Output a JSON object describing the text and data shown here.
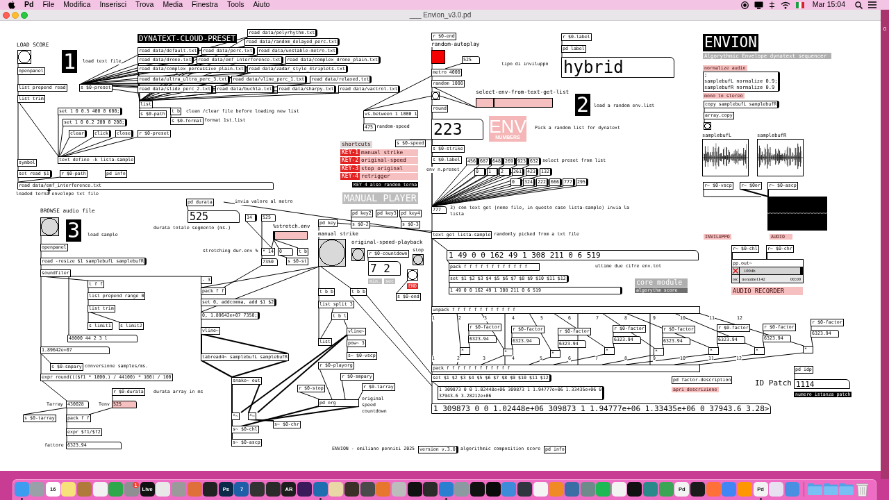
{
  "menu_bar": {
    "app_name": "Pd",
    "menus": [
      "File",
      "Modifica",
      "Inserisci",
      "Trova",
      "Media",
      "Finestra",
      "Tools",
      "Aiuto"
    ],
    "clock": "Mar 15:04"
  },
  "window": {
    "title": "___ Envion_v3.0.pd"
  },
  "desktop": {
    "edge_text": "0"
  },
  "patch": {
    "boxes": [
      {
        "kind": "comment",
        "text": "LOAD SCORE"
      },
      {
        "kind": "bang"
      },
      {
        "kind": "label",
        "text": "1",
        "color": "#000000"
      },
      {
        "kind": "comment",
        "text": "load text file"
      },
      {
        "kind": "object",
        "text": "openpanel"
      },
      {
        "kind": "object",
        "text": "list prepend read"
      },
      {
        "kind": "object",
        "text": "s $0-preset"
      },
      {
        "kind": "object",
        "text": "list trim"
      },
      {
        "kind": "message",
        "text": "set 1 0 0.5 400 0 600;"
      },
      {
        "kind": "message",
        "text": "set 1 0 0.2 200 0 200;"
      },
      {
        "kind": "message",
        "text": "clear"
      },
      {
        "kind": "message",
        "text": "click"
      },
      {
        "kind": "message",
        "text": "close"
      },
      {
        "kind": "object",
        "text": "r $0-preset"
      },
      {
        "kind": "object",
        "text": "text define -k lista-sample"
      },
      {
        "kind": "object",
        "text": "symbol"
      },
      {
        "kind": "message",
        "text": "set read $1"
      },
      {
        "kind": "object",
        "text": "r $0-path"
      },
      {
        "kind": "object",
        "text": "pd info"
      },
      {
        "kind": "symbol",
        "text": "read data/emf_interference.txt"
      },
      {
        "kind": "comment",
        "text": "loaded terna envelope txt file"
      },
      {
        "kind": "label",
        "text": "DYNATEXT-CLOUD-PRESET",
        "color": "#000000"
      },
      {
        "kind": "message",
        "text": "read data/polyrhythm.txt"
      },
      {
        "kind": "message",
        "text": "read data/random_delayed_perc.txt"
      },
      {
        "kind": "message",
        "text": "read data/default.txt"
      },
      {
        "kind": "message",
        "text": "read data/perc.txt"
      },
      {
        "kind": "message",
        "text": "read data/unstable-metro.txt"
      },
      {
        "kind": "message",
        "text": "read data/drone.txt"
      },
      {
        "kind": "message",
        "text": "read data/emf_interference.txt"
      },
      {
        "kind": "message",
        "text": "read data/complex_drone_plain.txt"
      },
      {
        "kind": "message",
        "text": "read data/complex_percussive_plain.txt"
      },
      {
        "kind": "message",
        "text": "read data/zadar_style_4triplets.txt"
      },
      {
        "kind": "message",
        "text": "read data/ultra_ultra_perc_3.txt"
      },
      {
        "kind": "message",
        "text": "read data/vline_perc_1.txt"
      },
      {
        "kind": "message",
        "text": "read data/relaxed.txt"
      },
      {
        "kind": "message",
        "text": "read data/slide_perc_2.txt"
      },
      {
        "kind": "message",
        "text": "read data/buchla.txt"
      },
      {
        "kind": "message",
        "text": "read data/sharpy.txt"
      },
      {
        "kind": "message",
        "text": "read data/vactrol.txt"
      },
      {
        "kind": "object",
        "text": "list"
      },
      {
        "kind": "object",
        "text": "s $0-path"
      },
      {
        "kind": "object",
        "text": "t b"
      },
      {
        "kind": "comment",
        "text": "clean /clear file before loading new list"
      },
      {
        "kind": "object",
        "text": "s $0-format"
      },
      {
        "kind": "comment",
        "text": "format 1st.list"
      },
      {
        "kind": "object",
        "text": "r $0-end"
      },
      {
        "kind": "comment",
        "text": "random-autoplay"
      },
      {
        "kind": "toggle",
        "color": "#f40000",
        "on": false
      },
      {
        "kind": "number",
        "text": "525"
      },
      {
        "kind": "object",
        "text": "metro 4000"
      },
      {
        "kind": "object",
        "text": "random 1000"
      },
      {
        "kind": "bang"
      },
      {
        "kind": "comment",
        "text": "select-env-from-text-get-list"
      },
      {
        "kind": "slider",
        "color": "#f7c0c0",
        "level": 0.22
      },
      {
        "kind": "object",
        "text": "round"
      },
      {
        "kind": "label",
        "text": "2",
        "color": "#000000"
      },
      {
        "kind": "comment",
        "text": "load a random env.list"
      },
      {
        "kind": "comment",
        "text": "tipo di inviluppo"
      },
      {
        "kind": "object",
        "text": "r $0-label"
      },
      {
        "kind": "object",
        "text": "pd label"
      },
      {
        "kind": "symbol",
        "text": "hybrid"
      },
      {
        "kind": "object",
        "text": "vs.between 1 1000 1"
      },
      {
        "kind": "number",
        "text": "475"
      },
      {
        "kind": "comment",
        "text": "random-speed"
      },
      {
        "kind": "number",
        "text": "223"
      },
      {
        "kind": "env_badge",
        "text": "ENV",
        "subtext": "NUMBERS",
        "color": "#f4b6b6"
      },
      {
        "kind": "comment",
        "text": "Pick a random list for dynatext"
      },
      {
        "kind": "label",
        "text": "shortcuts",
        "color": "#dcdcdc"
      },
      {
        "kind": "object",
        "text": "s $0-speed"
      },
      {
        "kind": "label",
        "text": "KEY-1",
        "color": "#e52222"
      },
      {
        "kind": "label",
        "text": "manual strike",
        "color": "#f7c0c0"
      },
      {
        "kind": "label",
        "text": "KEY-2",
        "color": "#e52222"
      },
      {
        "kind": "label",
        "text": "original-speed",
        "color": "#f7c0c0"
      },
      {
        "kind": "label",
        "text": "KEY-3",
        "color": "#e52222"
      },
      {
        "kind": "label",
        "text": "stop original",
        "color": "#f7c0c0"
      },
      {
        "kind": "label",
        "text": "KEY-4",
        "color": "#e52222"
      },
      {
        "kind": "label",
        "text": "retrigger",
        "color": "#f7c0c0"
      },
      {
        "kind": "label",
        "text": "KEY 4 also random terna",
        "color": "#000000"
      },
      {
        "kind": "label",
        "text": "MANUAL PLAYER",
        "color": "#bdbdbd"
      },
      {
        "kind": "object",
        "text": "pd key2"
      },
      {
        "kind": "object",
        "text": "pd key3"
      },
      {
        "kind": "object",
        "text": "pd key4"
      },
      {
        "kind": "object",
        "text": "s $0-strike"
      },
      {
        "kind": "object",
        "text": "s $0-label"
      },
      {
        "kind": "comment",
        "text": "env n.preset"
      },
      {
        "kind": "message",
        "text": "456"
      },
      {
        "kind": "message",
        "text": "687"
      },
      {
        "kind": "message",
        "text": "648"
      },
      {
        "kind": "message",
        "text": "269"
      },
      {
        "kind": "message",
        "text": "923"
      },
      {
        "kind": "message",
        "text": "632"
      },
      {
        "kind": "comment",
        "text": "select preset from list"
      },
      {
        "kind": "message",
        "text": "0"
      },
      {
        "kind": "message",
        "text": "1"
      },
      {
        "kind": "message",
        "text": "2"
      },
      {
        "kind": "message",
        "text": "261"
      },
      {
        "kind": "message",
        "text": "423"
      },
      {
        "kind": "message",
        "text": "132"
      },
      {
        "kind": "message",
        "text": "0"
      },
      {
        "kind": "message",
        "text": "324"
      },
      {
        "kind": "message",
        "text": "222"
      },
      {
        "kind": "message",
        "text": "666"
      },
      {
        "kind": "message",
        "text": "777"
      },
      {
        "kind": "message",
        "text": "295"
      },
      {
        "kind": "number",
        "text": "777"
      },
      {
        "kind": "comment",
        "text": "3) con text get (nome file, in questo caso lista-sample) invia la lista"
      },
      {
        "kind": "label",
        "text": "ENVION",
        "color": "#000000"
      },
      {
        "kind": "label",
        "text": "Algorythmic Envelope dynatext sequencer",
        "color": "#b0b0b0"
      },
      {
        "kind": "label",
        "text": "normalize audio",
        "color": "#f7c0c0"
      },
      {
        "kind": "message",
        "text": ";\nsamplebufL normalize 0.9;\nsamplebufR normalize 0.9"
      },
      {
        "kind": "label",
        "text": "mono to stereo",
        "color": "#f7c0c0"
      },
      {
        "kind": "message",
        "text": "copy samplebufL samplebufR"
      },
      {
        "kind": "object",
        "text": "array.copy"
      },
      {
        "kind": "bang"
      },
      {
        "kind": "array",
        "name": "samplebufL"
      },
      {
        "kind": "array",
        "name": "samplebufR"
      },
      {
        "kind": "object",
        "text": "r~ $0-vscp"
      },
      {
        "kind": "object",
        "text": "r~ $0or"
      },
      {
        "kind": "object",
        "text": "r~ $0-ascp"
      },
      {
        "kind": "scope"
      },
      {
        "kind": "label",
        "text": "INVILUPPO",
        "color": "#f7c0c0"
      },
      {
        "kind": "label",
        "text": "AUDIO",
        "color": "#f7c0c0"
      },
      {
        "kind": "object",
        "text": "r~ $0-chl"
      },
      {
        "kind": "object",
        "text": "r~ $0-chr"
      },
      {
        "kind": "recorder",
        "title": "pp.out~",
        "toggle_on": true,
        "gain_label": "100db",
        "level": 1,
        "rec_label": "rec",
        "file": "noname1142",
        "time": "00:00"
      },
      {
        "kind": "label",
        "text": "AUDIO RECORDER",
        "color": "#f7c0c0"
      },
      {
        "kind": "comment",
        "text": "BROWSE audio file"
      },
      {
        "kind": "bang",
        "color": "#d9d9d9"
      },
      {
        "kind": "label",
        "text": "3",
        "color": "#000000"
      },
      {
        "kind": "comment",
        "text": "load sample"
      },
      {
        "kind": "object",
        "text": "openpanel"
      },
      {
        "kind": "message",
        "text": "read -resize $1 samplebufL samplebufR"
      },
      {
        "kind": "object",
        "text": "soundfiler"
      },
      {
        "kind": "object",
        "text": "t f f"
      },
      {
        "kind": "object",
        "text": "list prepend range 0"
      },
      {
        "kind": "object",
        "text": "list trim"
      },
      {
        "kind": "object",
        "text": "s limit1"
      },
      {
        "kind": "object",
        "text": "s limit2"
      },
      {
        "kind": "list",
        "text": "48000 44 2 3 l"
      },
      {
        "kind": "number",
        "text": "1.89642e+07"
      },
      {
        "kind": "object",
        "text": "s $0-smpary"
      },
      {
        "kind": "comment",
        "text": "conversione samples/ms."
      },
      {
        "kind": "object",
        "text": "expr round((($f1 * 1000.) / 44100) * 100) / 100"
      },
      {
        "kind": "object",
        "text": "r $0-durata"
      },
      {
        "kind": "comment",
        "text": "durata array in ms"
      },
      {
        "kind": "comment",
        "text": "Tarray"
      },
      {
        "kind": "number",
        "text": "430028"
      },
      {
        "kind": "comment",
        "text": "Tenv"
      },
      {
        "kind": "number",
        "text": "525",
        "color": "#f7c0c0"
      },
      {
        "kind": "object",
        "text": "s $0-tarray"
      },
      {
        "kind": "object",
        "text": "pack f f"
      },
      {
        "kind": "object",
        "text": "expr $f1/$f2"
      },
      {
        "kind": "comment",
        "text": "fattore"
      },
      {
        "kind": "number",
        "text": "6323.94"
      },
      {
        "kind": "object",
        "text": "pd durata"
      },
      {
        "kind": "comment",
        "text": "invia valore al metro"
      },
      {
        "kind": "number",
        "text": "525"
      },
      {
        "kind": "comment",
        "text": "durata totale segmento (ms.)"
      },
      {
        "kind": "message",
        "text": "14"
      },
      {
        "kind": "number",
        "text": "525"
      },
      {
        "kind": "comment",
        "text": "%stretch.env"
      },
      {
        "kind": "slider",
        "color": "#f7c0c0",
        "level": 0
      },
      {
        "kind": "comment",
        "text": "stretching dur.env %"
      },
      {
        "kind": "object",
        "text": "* 14"
      },
      {
        "kind": "number",
        "text": "0"
      },
      {
        "kind": "object",
        "text": "t b"
      },
      {
        "kind": "number",
        "text": "7350"
      },
      {
        "kind": "object",
        "text": "s $0-st"
      },
      {
        "kind": "object",
        "text": "pd key"
      },
      {
        "kind": "comment",
        "text": "manual strike"
      },
      {
        "kind": "bang",
        "color": "#d9d9d9"
      },
      {
        "kind": "object",
        "text": "s $0-2"
      },
      {
        "kind": "object",
        "text": "s $0-3"
      },
      {
        "kind": "comment",
        "text": "original-speed-playback"
      },
      {
        "kind": "bang",
        "color": "#d9d9d9"
      },
      {
        "kind": "object",
        "text": "r $0-countdown"
      },
      {
        "kind": "comment",
        "text": "stop"
      },
      {
        "kind": "bang",
        "color": "#d9d9d9"
      },
      {
        "kind": "list",
        "text": "7 2"
      },
      {
        "kind": "label",
        "text": "min.",
        "color": "#bdbdbd"
      },
      {
        "kind": "label",
        "text": "sec",
        "color": "#bdbdbd"
      },
      {
        "kind": "bang"
      },
      {
        "kind": "label",
        "text": "END",
        "color": "#e52222"
      },
      {
        "kind": "object",
        "text": "s $0-end"
      },
      {
        "kind": "object",
        "text": "- 3"
      },
      {
        "kind": "object",
        "text": "pack f f"
      },
      {
        "kind": "message",
        "text": "set 0, addcomma, add $1 $2"
      },
      {
        "kind": "message",
        "text": "0, 1.89642e+07 7350;"
      },
      {
        "kind": "object",
        "text": "vline~"
      },
      {
        "kind": "object",
        "text": "tabread4~ samplebufL samplebufR"
      },
      {
        "kind": "object",
        "text": "snake~ out"
      },
      {
        "kind": "object",
        "text": "*~"
      },
      {
        "kind": "object",
        "text": "*~"
      },
      {
        "kind": "object",
        "text": "s~ $0-chl"
      },
      {
        "kind": "object",
        "text": "s~ $0-chr"
      },
      {
        "kind": "object",
        "text": "s~ $0-ascp"
      },
      {
        "kind": "object",
        "text": "t b b"
      },
      {
        "kind": "object",
        "text": "t b b"
      },
      {
        "kind": "object",
        "text": "list split 3"
      },
      {
        "kind": "object",
        "text": "t b l"
      },
      {
        "kind": "object",
        "text": "list"
      },
      {
        "kind": "object",
        "text": "vline~"
      },
      {
        "kind": "object",
        "text": "pow~ 3"
      },
      {
        "kind": "object",
        "text": "s~ $0-vscp"
      },
      {
        "kind": "object",
        "text": "r $0-playorg"
      },
      {
        "kind": "object",
        "text": "r $0-smpary"
      },
      {
        "kind": "object",
        "text": "r $0-stop"
      },
      {
        "kind": "object",
        "text": "r $0-tarray"
      },
      {
        "kind": "object",
        "text": "pd org"
      },
      {
        "kind": "comment",
        "text": "original speed countdown"
      },
      {
        "kind": "comment",
        "text": "ENVION - emiliano pennisi 2025"
      },
      {
        "kind": "object",
        "text": "text get lista-sample"
      },
      {
        "kind": "comment",
        "text": "randomly picked from a txt file"
      },
      {
        "kind": "list",
        "text": "1 49 0 0 162 49 1 308 211 0 6 519"
      },
      {
        "kind": "object",
        "text": "pack f f f f f f f f f f f f"
      },
      {
        "kind": "comment",
        "text": "ultime due cifre env.tot"
      },
      {
        "kind": "message",
        "text": "set $1 $2 $3 $4 $5 $6 $7 $8 $9 $10 $11 $12"
      },
      {
        "kind": "message",
        "text": "1 49 0 0 162 49 1 308 211 0 6 519"
      },
      {
        "kind": "label",
        "text": "core module",
        "color": "#b0b0b0"
      },
      {
        "kind": "label",
        "text": "algorythm score",
        "color": "#6e6e6e"
      },
      {
        "kind": "object",
        "text": "unpack f f f f f f f f f f f f"
      },
      {
        "kind": "comment",
        "text": "1"
      },
      {
        "kind": "comment",
        "text": "2"
      },
      {
        "kind": "comment",
        "text": "3"
      },
      {
        "kind": "comment",
        "text": "4"
      },
      {
        "kind": "comment",
        "text": "5"
      },
      {
        "kind": "comment",
        "text": "6"
      },
      {
        "kind": "comment",
        "text": "7"
      },
      {
        "kind": "comment",
        "text": "8"
      },
      {
        "kind": "comment",
        "text": "9"
      },
      {
        "kind": "comment",
        "text": "10"
      },
      {
        "kind": "comment",
        "text": "11"
      },
      {
        "kind": "comment",
        "text": "12"
      },
      {
        "kind": "object",
        "text": "r $0-factor"
      },
      {
        "kind": "object",
        "text": "r $0-factor"
      },
      {
        "kind": "object",
        "text": "r $0-factor"
      },
      {
        "kind": "object",
        "text": "r $0-factor"
      },
      {
        "kind": "object",
        "text": "r $0-factor"
      },
      {
        "kind": "object",
        "text": "r $0-factor"
      },
      {
        "kind": "object",
        "text": "r $0-factor"
      },
      {
        "kind": "object",
        "text": "r $0-factor"
      },
      {
        "kind": "number",
        "text": "6323.94"
      },
      {
        "kind": "number",
        "text": "6323.94"
      },
      {
        "kind": "number",
        "text": "6323.94"
      },
      {
        "kind": "number",
        "text": "6323.94"
      },
      {
        "kind": "number",
        "text": "6323.94"
      },
      {
        "kind": "number",
        "text": "6323.94"
      },
      {
        "kind": "number",
        "text": "6323.94"
      },
      {
        "kind": "number",
        "text": "6323.94"
      },
      {
        "kind": "object",
        "text": "*"
      },
      {
        "kind": "object",
        "text": "*"
      },
      {
        "kind": "object",
        "text": "*"
      },
      {
        "kind": "object",
        "text": "*"
      },
      {
        "kind": "object",
        "text": "*"
      },
      {
        "kind": "object",
        "text": "*"
      },
      {
        "kind": "object",
        "text": "*"
      },
      {
        "kind": "object",
        "text": "*"
      },
      {
        "kind": "comment",
        "text": "1"
      },
      {
        "kind": "comment",
        "text": "2"
      },
      {
        "kind": "comment",
        "text": "3"
      },
      {
        "kind": "comment",
        "text": "4"
      },
      {
        "kind": "comment",
        "text": "5"
      },
      {
        "kind": "comment",
        "text": "6"
      },
      {
        "kind": "comment",
        "text": "7"
      },
      {
        "kind": "comment",
        "text": "8"
      },
      {
        "kind": "comment",
        "text": "9"
      },
      {
        "kind": "comment",
        "text": "10"
      },
      {
        "kind": "comment",
        "text": "11"
      },
      {
        "kind": "comment",
        "text": "12"
      },
      {
        "kind": "object",
        "text": "pack f f f f f f f f f f f f"
      },
      {
        "kind": "message",
        "text": "set $1 $2 $3 $4 $5 $6 $7 $8 $9 $10 $11 $12"
      },
      {
        "kind": "message",
        "text": "1 309873 0 0 1.02448e+06 309873 1 1.94777e+06 1.33435e+06 0\n37943.6 3.28212e+06"
      },
      {
        "kind": "object",
        "text": "pd factor-description"
      },
      {
        "kind": "label",
        "text": "apri descrizione",
        "color": "#f7c0c0"
      },
      {
        "kind": "object",
        "text": "pd idp"
      },
      {
        "kind": "comment",
        "text": "ID Patch"
      },
      {
        "kind": "number",
        "text": "1114"
      },
      {
        "kind": "label",
        "text": "numero istanza patch",
        "color": "#000000"
      },
      {
        "kind": "list",
        "text": "1 309873 0 0 1.02448e+06 309873 1 1.94777e+06 1.33435e+06 0 37943.6 3.28>"
      },
      {
        "kind": "message",
        "text": "version v.3.0"
      },
      {
        "kind": "comment",
        "text": "algorithmic composition score"
      },
      {
        "kind": "object",
        "text": "pd info"
      }
    ]
  },
  "dock": {
    "apps": [
      {
        "color": "#3b9cf0",
        "running": true
      },
      {
        "color": "#9aa0a8",
        "running": false
      },
      {
        "color": "#ffffff",
        "label": "16",
        "running": false
      },
      {
        "color": "#f7e27a",
        "running": false
      },
      {
        "color": "#b07a3a",
        "running": false
      },
      {
        "color": "#f2f2f2",
        "running": false
      },
      {
        "color": "#2ea84a",
        "running": false
      },
      {
        "color": "#8e8e93",
        "badge": "1",
        "running": false
      },
      {
        "color": "#111111",
        "label": "Live",
        "running": false
      },
      {
        "color": "#e8e8e8",
        "running": false
      },
      {
        "color": "#9a9a9a",
        "running": false
      },
      {
        "color": "#e0703a",
        "running": false
      },
      {
        "color": "#222222",
        "running": false
      },
      {
        "color": "#0b2a4a",
        "label": "Ps",
        "running": false
      },
      {
        "color": "#1e5fa8",
        "label": "7",
        "running": false
      },
      {
        "color": "#333333",
        "running": false
      },
      {
        "color": "#2a2a2a",
        "running": false
      },
      {
        "color": "#1d1d1d",
        "label": "AR",
        "running": false
      },
      {
        "color": "#3a1a5a",
        "running": false
      },
      {
        "color": "#1f6fb0",
        "running": true
      },
      {
        "color": "#e9d8a6",
        "running": false
      },
      {
        "color": "#3a3028",
        "running": false
      },
      {
        "color": "#4a4a4a",
        "running": false
      },
      {
        "color": "#e8772e",
        "running": false
      },
      {
        "color": "#bcbcbc",
        "running": false
      },
      {
        "color": "#111111",
        "running": false
      },
      {
        "color": "#2b2b2b",
        "running": false
      },
      {
        "color": "#2a7fd0",
        "running": true
      },
      {
        "color": "#8a9aa0",
        "running": false
      },
      {
        "color": "#111111",
        "running": false
      },
      {
        "color": "#0a0a0a",
        "running": false
      },
      {
        "color": "#3d8bd9",
        "running": false
      },
      {
        "color": "#303640",
        "running": false
      },
      {
        "color": "#f4f4f4",
        "running": false
      },
      {
        "color": "#f08a24",
        "running": false
      },
      {
        "color": "#3a6ea5",
        "running": false
      },
      {
        "color": "#6e8a8a",
        "running": false
      },
      {
        "color": "#1db954",
        "running": false
      },
      {
        "color": "#f2f2f2",
        "running": false
      },
      {
        "color": "#111111",
        "running": false
      },
      {
        "color": "#2a8a8a",
        "running": false
      },
      {
        "color": "#3aa655",
        "running": false
      },
      {
        "color": "#f2f2f2",
        "label": "Pd",
        "running": false
      },
      {
        "color": "#1b1b1b",
        "running": false
      },
      {
        "color": "#ff7139",
        "running": false
      },
      {
        "color": "#4285f4",
        "running": false
      },
      {
        "color": "#ff9800",
        "running": false
      },
      {
        "color": "#f2f2f2",
        "label": "Pd",
        "running": true
      },
      {
        "color": "#e8e0f0",
        "running": false
      },
      {
        "color": "#4a90e2",
        "running": false
      }
    ],
    "stacks": [
      {
        "kind": "folder"
      },
      {
        "kind": "folder"
      },
      {
        "kind": "folder"
      },
      {
        "kind": "trash"
      }
    ]
  }
}
